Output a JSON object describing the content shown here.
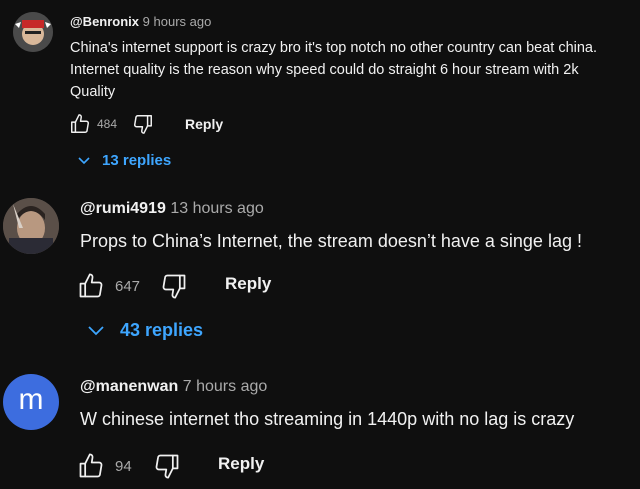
{
  "comments": [
    {
      "author": "@Benronix",
      "time": "9 hours ago",
      "text_lines": [
        "China's internet support is crazy bro it's top notch no other country can beat china.",
        "Internet quality is the reason why speed could do straight 6 hour stream with 2k",
        "Quality"
      ],
      "likes": "484",
      "reply_label": "Reply",
      "replies_label": "13 replies"
    },
    {
      "author": "@rumi4919",
      "time": "13 hours ago",
      "text": "Props to China’s Internet, the stream doesn’t have a singe lag !",
      "likes": "647",
      "reply_label": "Reply",
      "replies_label": "43 replies"
    },
    {
      "author": "@manenwan",
      "time": "7 hours ago",
      "avatar_letter": "m",
      "avatar_color": "#3d6ddf",
      "text": "W chinese internet tho streaming in 1440p with no lag is crazy",
      "likes": "94",
      "reply_label": "Reply"
    }
  ],
  "colors": {
    "background": "#0f0f0f",
    "link": "#3ea6ff",
    "muted": "#aaaaaa"
  }
}
